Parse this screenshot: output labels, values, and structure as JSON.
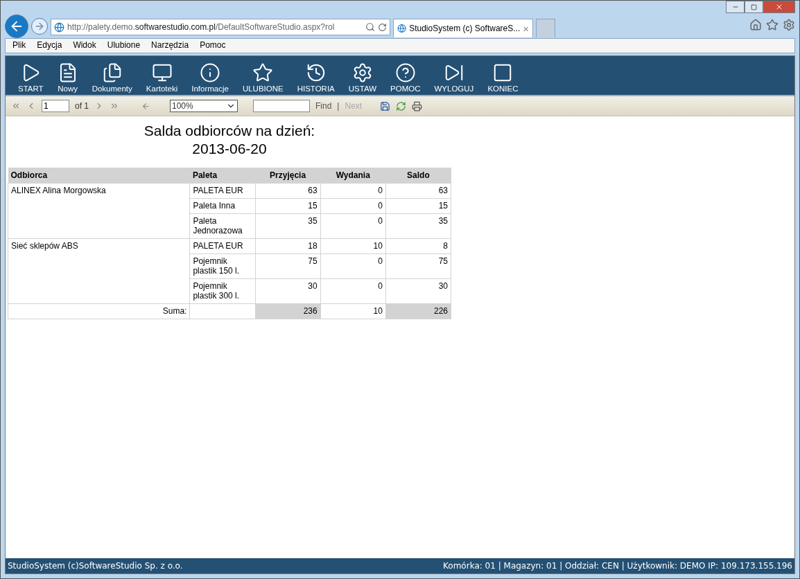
{
  "browser": {
    "address": "http://palety.demo.**softwarestudio.com.pl**/DefaultSoftwareStudio.aspx?rol",
    "tab": {
      "title": "StudioSystem (c) SoftwareS...",
      "close": "×",
      "selected": true
    }
  },
  "menu": [
    "Plik",
    "Edycja",
    "Widok",
    "Ulubione",
    "Narzędzia",
    "Pomoc"
  ],
  "toolbar": [
    "START",
    "Nowy",
    "Dokumenty",
    "Kartoteki",
    "Informacje",
    "ULUBIONE",
    "HISTORIA",
    "USTAW",
    "POMOC",
    "WYLOGUJ",
    "KONIEC"
  ],
  "report_toolbar": {
    "page": "1",
    "of": "of 1",
    "zoom": "100%",
    "find": "Find",
    "separator": "|",
    "next": "Next",
    "next_disabled": true
  },
  "report": {
    "title": "Salda odbiorców na dzień:",
    "date": "2013-06-20",
    "columns": [
      "Odbiorca",
      "Paleta",
      "Przyjęcia",
      "Wydania",
      "Saldo"
    ],
    "groups": [
      {
        "customer": "ALINEX Alina Morgowska",
        "rows": [
          {
            "paleta": "PALETA EUR",
            "przyjecia": "63",
            "wydania": "0",
            "saldo": "63"
          },
          {
            "paleta": "Paleta Inna",
            "przyjecia": "15",
            "wydania": "0",
            "saldo": "15"
          },
          {
            "paleta": "Paleta Jednorazowa",
            "przyjecia": "35",
            "wydania": "0",
            "saldo": "35"
          }
        ]
      },
      {
        "customer": "Sieć sklepów ABS",
        "rows": [
          {
            "paleta": "PALETA EUR",
            "przyjecia": "18",
            "wydania": "10",
            "saldo": "8"
          },
          {
            "paleta": "Pojemnik plastik 150 l.",
            "przyjecia": "75",
            "wydania": "0",
            "saldo": "75"
          },
          {
            "paleta": "Pojemnik plastik 300 l.",
            "przyjecia": "30",
            "wydania": "0",
            "saldo": "30"
          }
        ]
      }
    ],
    "total": {
      "label": "Suma:",
      "przyjecia": "236",
      "wydania": "10",
      "saldo": "226"
    }
  },
  "status_bar": {
    "left": "StudioSystem (c)SoftwareStudio Sp. z o.o.",
    "right": "Komórka: 01 | Magazyn: 01 | Oddział: CEN | Użytkownik: DEMO IP: 109.173.155.196"
  }
}
